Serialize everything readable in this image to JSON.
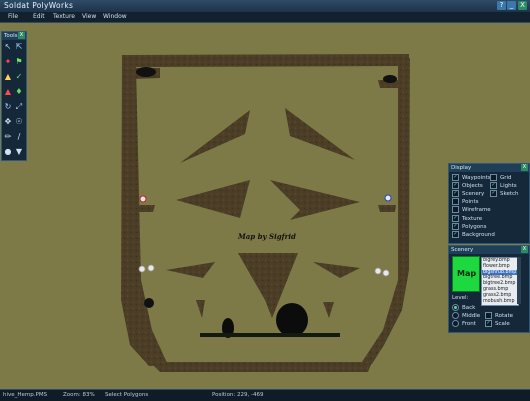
{
  "window": {
    "title": "Soldat PolyWorks",
    "help": "?",
    "minimize": "_",
    "close": "X"
  },
  "menu": {
    "items": [
      "File",
      "Edit",
      "Texture",
      "View",
      "Window"
    ]
  },
  "tools": {
    "title": "Tools",
    "close": "X",
    "icons": [
      "select-arrow-icon",
      "vertex-select-icon",
      "pan-hand-icon",
      "spawn-flag-icon",
      "polygon-icon",
      "color-picker-icon",
      "scenery-tree-icon",
      "waypoint-icon",
      "rotate-icon",
      "scale-icon",
      "move-icon",
      "eyedropper-icon",
      "pencil-icon",
      "line-icon",
      "sphere-icon",
      "arrow-down-icon"
    ]
  },
  "map": {
    "label": "Map by Sigfrid",
    "background_color": "#7d7a47",
    "ground_color": "#4b3d26"
  },
  "display": {
    "title": "Display",
    "close": "X",
    "left": [
      {
        "label": "Waypoints",
        "checked": true
      },
      {
        "label": "Objects",
        "checked": true
      },
      {
        "label": "Scenery",
        "checked": true
      },
      {
        "label": "Points",
        "checked": false
      },
      {
        "label": "Wireframe",
        "checked": false
      },
      {
        "label": "Texture",
        "checked": true
      },
      {
        "label": "Polygons",
        "checked": true
      },
      {
        "label": "Background",
        "checked": true
      }
    ],
    "right": [
      {
        "label": "Grid",
        "checked": false
      },
      {
        "label": "Lights",
        "checked": true
      },
      {
        "label": "Sketch",
        "checked": true
      }
    ]
  },
  "scenery": {
    "title": "Scenery",
    "close": "X",
    "preview_label": "Map",
    "preview_color": "#1ed840",
    "textures": [
      "bigrey.bmp",
      "flower.bmp",
      "bigshrub.bmp",
      "bigtree.bmp",
      "bigtree2.bmp",
      "grass.bmp",
      "grass2.bmp",
      "mobush.bmp"
    ],
    "selected_index": 2,
    "level_label": "Level:",
    "levels": [
      {
        "label": "Back",
        "on": true
      },
      {
        "label": "Middle",
        "on": false
      },
      {
        "label": "Front",
        "on": false
      }
    ],
    "rotate_label": "Rotate",
    "rotate_checked": false,
    "scale_label": "Scale",
    "scale_checked": true
  },
  "status": {
    "file": "hive_Hemp.PMS",
    "zoom": "Zoom: 83%",
    "tool": "Select Polygons",
    "position": "Position: 229, -469"
  }
}
